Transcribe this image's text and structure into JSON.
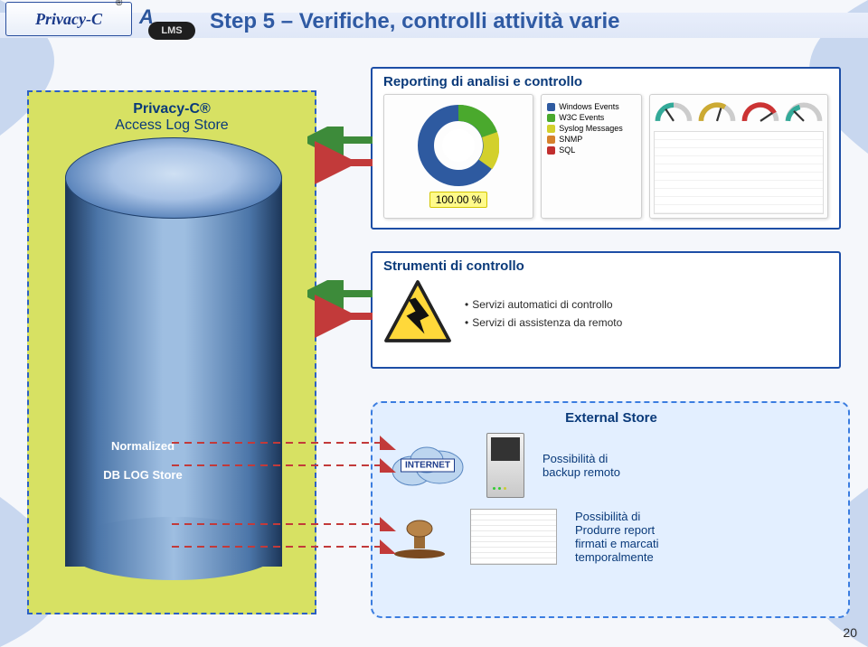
{
  "title": "Step 5 – Verifiche, controlli attività varie",
  "page_number": "20",
  "logo": {
    "brand": "Privacy-C",
    "reg": "®",
    "a": "A",
    "lms": "LMS"
  },
  "cylinder": {
    "title_line1": "Privacy-C®",
    "title_line2": "Access Log Store",
    "inner_line1": "Normalized",
    "inner_line2": "DB LOG Store"
  },
  "reporting": {
    "title": "Reporting di analisi e controllo",
    "donut_pct": "100.00 %",
    "legend": [
      {
        "color": "#2e5aa0",
        "label": "Windows Events"
      },
      {
        "color": "#4aa92d",
        "label": "W3C Events"
      },
      {
        "color": "#d3d02c",
        "label": "Syslog Messages"
      },
      {
        "color": "#d6812c",
        "label": "SNMP"
      },
      {
        "color": "#c12e2e",
        "label": "SQL"
      }
    ]
  },
  "strumenti": {
    "title": "Strumenti di controllo",
    "bullets": [
      "Servizi automatici di controllo",
      "Servizi di assistenza da remoto"
    ]
  },
  "external": {
    "title": "External Store",
    "internet_label": "INTERNET",
    "line1": "Possibilità di",
    "line2": "backup remoto",
    "line3": "Possibilità di",
    "line4": "Produrre report",
    "line5": "firmati e marcati",
    "line6": "temporalmente"
  }
}
